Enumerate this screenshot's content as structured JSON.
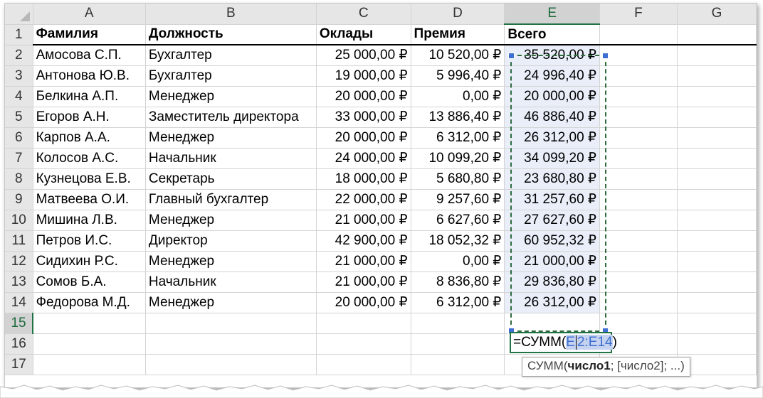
{
  "columns": [
    "A",
    "B",
    "C",
    "D",
    "E",
    "F",
    "G"
  ],
  "row_numbers": [
    "1",
    "2",
    "3",
    "4",
    "5",
    "6",
    "7",
    "8",
    "9",
    "10",
    "11",
    "12",
    "13",
    "14",
    "15",
    "16",
    "17"
  ],
  "header": {
    "surname": "Фамилия",
    "position": "Должность",
    "salary": "Оклады",
    "bonus": "Премия",
    "total": "Всего"
  },
  "rows": [
    {
      "surname": "Амосова С.П.",
      "position": "Бухгалтер",
      "salary": "25 000,00 ₽",
      "bonus": "10 520,00 ₽",
      "total": "35 520,00 ₽"
    },
    {
      "surname": "Антонова Ю.В.",
      "position": "Бухгалтер",
      "salary": "19 000,00 ₽",
      "bonus": "5 996,40 ₽",
      "total": "24 996,40 ₽"
    },
    {
      "surname": "Белкина А.П.",
      "position": "Менеджер",
      "salary": "20 000,00 ₽",
      "bonus": "0,00 ₽",
      "total": "20 000,00 ₽"
    },
    {
      "surname": "Егоров А.Н.",
      "position": "Заместитель директора",
      "salary": "33 000,00 ₽",
      "bonus": "13 886,40 ₽",
      "total": "46 886,40 ₽"
    },
    {
      "surname": "Карпов А.А.",
      "position": "Менеджер",
      "salary": "20 000,00 ₽",
      "bonus": "6 312,00 ₽",
      "total": "26 312,00 ₽"
    },
    {
      "surname": "Колосов А.С.",
      "position": "Начальник",
      "salary": "24 000,00 ₽",
      "bonus": "10 099,20 ₽",
      "total": "34 099,20 ₽"
    },
    {
      "surname": "Кузнецова Е.В.",
      "position": "Секретарь",
      "salary": "18 000,00 ₽",
      "bonus": "5 680,80 ₽",
      "total": "23 680,80 ₽"
    },
    {
      "surname": "Матвеева О.И.",
      "position": "Главный бухгалтер",
      "salary": "22 000,00 ₽",
      "bonus": "9 257,60 ₽",
      "total": "31 257,60 ₽"
    },
    {
      "surname": "Мишина Л.В.",
      "position": "Менеджер",
      "salary": "21 000,00 ₽",
      "bonus": "6 627,60 ₽",
      "total": "27 627,60 ₽"
    },
    {
      "surname": "Петров И.С.",
      "position": "Директор",
      "salary": "42 900,00 ₽",
      "bonus": "18 052,32 ₽",
      "total": "60 952,32 ₽"
    },
    {
      "surname": "Сидихин Р.С.",
      "position": "Менеджер",
      "salary": "21 000,00 ₽",
      "bonus": "0,00 ₽",
      "total": "21 000,00 ₽"
    },
    {
      "surname": "Сомов Б.А.",
      "position": "Начальник",
      "salary": "21 000,00 ₽",
      "bonus": "8 836,80 ₽",
      "total": "29 836,80 ₽"
    },
    {
      "surname": "Федорова М.Д.",
      "position": "Менеджер",
      "salary": "20 000,00 ₽",
      "bonus": "6 312,00 ₽",
      "total": "26 312,00 ₽"
    }
  ],
  "formula": {
    "prefix": "=СУММ(",
    "ref_first": "E",
    "ref_rest": "2:E14",
    "suffix": ")"
  },
  "tooltip": {
    "fn": "СУММ(",
    "arg1": "число1",
    "rest": "; [число2]; ...)"
  },
  "colors": {
    "accent": "#217346",
    "ref": "#3c6fd1",
    "selection_fill": "#e9eef9"
  }
}
